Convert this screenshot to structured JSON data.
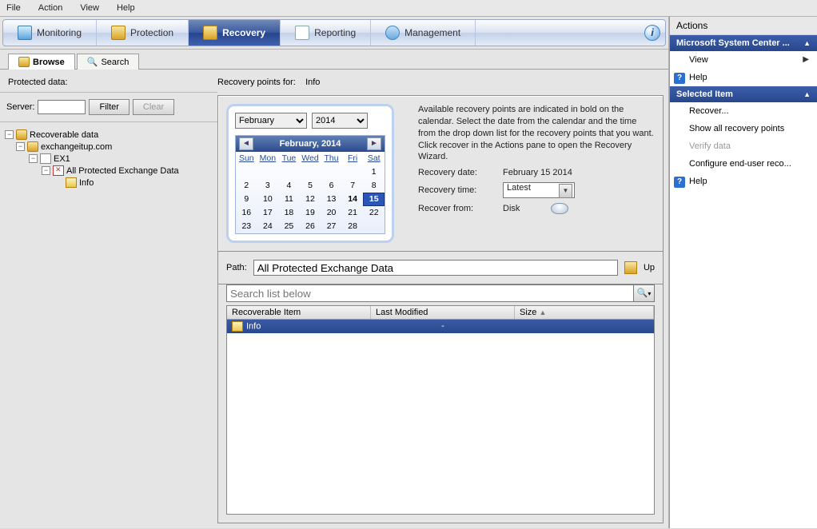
{
  "menu": {
    "file": "File",
    "action": "Action",
    "view": "View",
    "help": "Help"
  },
  "nav": {
    "monitoring": "Monitoring",
    "protection": "Protection",
    "recovery": "Recovery",
    "reporting": "Reporting",
    "management": "Management"
  },
  "tabs": {
    "browse": "Browse",
    "search": "Search"
  },
  "labels": {
    "protected": "Protected data:",
    "points_for": "Recovery points for:",
    "points_val": "Info",
    "server": "Server:",
    "filter": "Filter",
    "clear": "Clear",
    "path": "Path:",
    "up": "Up",
    "search_placeholder": "Search list below"
  },
  "tree": {
    "root": "Recoverable data",
    "domain": "exchangeitup.com",
    "server": "EX1",
    "group": "All Protected Exchange Data",
    "leaf": "Info"
  },
  "calendar": {
    "month_sel": "February",
    "year_sel": "2014",
    "title": "February, 2014",
    "dows": [
      "Sun",
      "Mon",
      "Tue",
      "Wed",
      "Thu",
      "Fri",
      "Sat"
    ],
    "weeks": [
      [
        "",
        "",
        "",
        "",
        "",
        "1",
        "2"
      ],
      [
        "3",
        "4",
        "5",
        "6",
        "7",
        "8",
        "9"
      ],
      [
        "10",
        "11",
        "12",
        "13",
        "14",
        "15",
        "16"
      ],
      [
        "17",
        "18",
        "19",
        "20",
        "21",
        "22",
        "23"
      ],
      [
        "24",
        "25",
        "26",
        "27",
        "28",
        "",
        ""
      ]
    ],
    "offset": 6,
    "bold_days": [
      "14",
      "15"
    ],
    "selected": "15"
  },
  "recovery": {
    "blurb": "Available recovery points are indicated in bold on the calendar. Select the date from the calendar and the time from the drop down list for the recovery points that you want. Click recover in the Actions pane to open the Recovery Wizard.",
    "date_k": "Recovery date:",
    "date_v": "February 15  2014",
    "time_k": "Recovery time:",
    "time_v": "Latest",
    "from_k": "Recover from:",
    "from_v": "Disk"
  },
  "path_value": "All Protected Exchange Data",
  "grid": {
    "cols": [
      "Recoverable Item",
      "Last Modified",
      "Size"
    ],
    "row": {
      "item": "Info",
      "modified": "-",
      "size": ""
    }
  },
  "actions": {
    "title": "Actions",
    "hdr1": "Microsoft System Center ...",
    "view": "View",
    "help": "Help",
    "hdr2": "Selected Item",
    "recover": "Recover...",
    "show": "Show all recovery points",
    "verify": "Verify data",
    "config": "Configure end-user reco..."
  }
}
